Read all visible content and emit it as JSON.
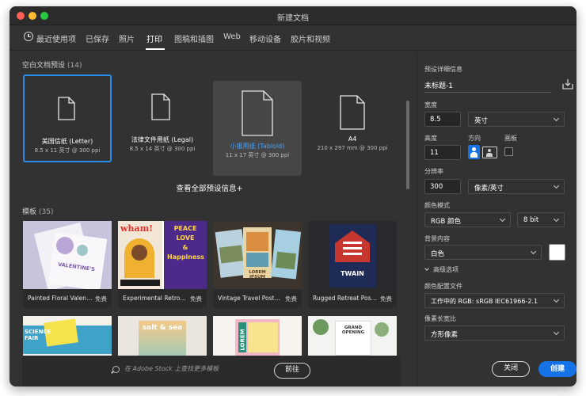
{
  "window": {
    "title": "新建文档"
  },
  "tabs": [
    {
      "label": "最近使用项"
    },
    {
      "label": "已保存"
    },
    {
      "label": "照片"
    },
    {
      "label": "打印"
    },
    {
      "label": "图稿和插图"
    },
    {
      "label": "Web"
    },
    {
      "label": "移动设备"
    },
    {
      "label": "胶片和视频"
    }
  ],
  "blank_presets": {
    "title": "空白文档预设",
    "count": "(14)",
    "items": [
      {
        "name": "美国信纸 (Letter)",
        "size": "8.5 x 11 英寸 @ 300 ppi"
      },
      {
        "name": "法律文件用纸 (Legal)",
        "size": "8.5 x 14 英寸 @ 300 ppi"
      },
      {
        "name": "小报用纸 (Tabloid)",
        "size": "11 x 17 英寸 @ 300 ppi"
      },
      {
        "name": "A4",
        "size": "210 x 297 mm @ 300 ppi"
      }
    ],
    "view_all": "查看全部预设信息+"
  },
  "templates": {
    "title": "模板",
    "count": "(35)",
    "items": [
      {
        "name": "Painted Floral Valentine...",
        "badge": "免费",
        "thumb_text": "VALENTINE'S"
      },
      {
        "name": "Experimental Retro P...",
        "badge": "免费",
        "thumb_text": "wham!",
        "thumb_text2": "PEACE LOVE & Happiness"
      },
      {
        "name": "Vintage Travel Poster...",
        "badge": "免费",
        "thumb_text": "LOREM IPSUM"
      },
      {
        "name": "Rugged Retreat Post...",
        "badge": "免费",
        "thumb_text": "TWAIN"
      }
    ],
    "row2": [
      {
        "thumb_text": "SCIENCE FAIR"
      },
      {
        "thumb_text": "salt & sea"
      },
      {
        "thumb_text": "LOREM"
      },
      {
        "thumb_text": "GRAND OPENING"
      }
    ]
  },
  "stock_search": {
    "placeholder": "在 Adobe Stock 上查找更多模板",
    "go_label": "前往"
  },
  "details": {
    "heading": "预设详细信息",
    "doc_name": "未标题-1",
    "width_label": "宽度",
    "width_value": "8.5",
    "width_unit": "英寸",
    "height_label": "高度",
    "height_value": "11",
    "orientation_label": "方向",
    "artboard_label": "画板",
    "resolution_label": "分辨率",
    "resolution_value": "300",
    "resolution_unit": "像素/英寸",
    "color_mode_label": "颜色模式",
    "color_mode_value": "RGB 颜色",
    "bit_depth": "8 bit",
    "bg_label": "背景内容",
    "bg_value": "白色",
    "advanced_label": "高级选项",
    "profile_label": "颜色配置文件",
    "profile_value": "工作中的 RGB: sRGB IEC61966-2.1",
    "pixel_aspect_label": "像素长宽比",
    "pixel_aspect_value": "方形像素"
  },
  "buttons": {
    "close": "关闭",
    "create": "创建"
  },
  "colors": {
    "accent": "#1473e6",
    "selection": "#2a8ae9",
    "panel_bg": "#323232"
  }
}
